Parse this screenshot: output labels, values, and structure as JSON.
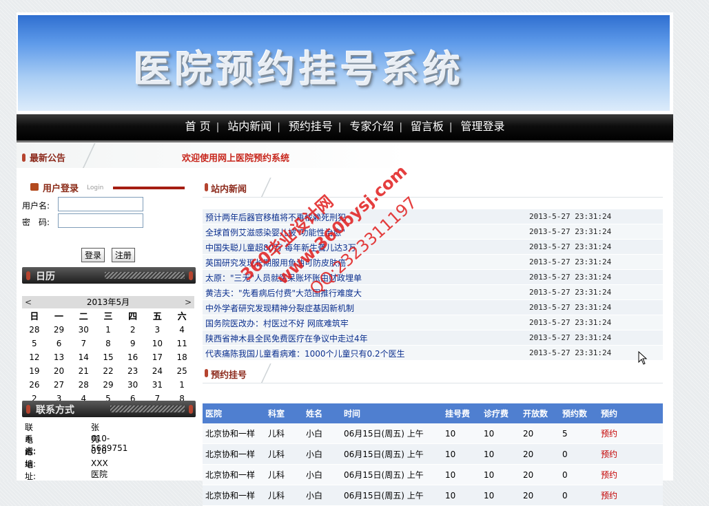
{
  "banner": {
    "title": "医院预约挂号系统"
  },
  "nav": {
    "items": [
      "首 页",
      "站内新闻",
      "预约挂号",
      "专家介绍",
      "留言板",
      "管理登录"
    ]
  },
  "notice": {
    "label": "最新公告",
    "message": "欢迎使用网上医院预约系统"
  },
  "login": {
    "title": "用户登录",
    "subtitle": "Login",
    "username_label": "用户名:",
    "password_label": "密　码:",
    "username_value": "",
    "password_value": "",
    "login_button": "登录",
    "register_button": "注册"
  },
  "calendar": {
    "title": "日历",
    "month_label": "2013年5月",
    "prev": "<",
    "next": ">",
    "weekdays": [
      "日",
      "一",
      "二",
      "三",
      "四",
      "五",
      "六"
    ],
    "weeks": [
      [
        "28",
        "29",
        "30",
        "1",
        "2",
        "3",
        "4"
      ],
      [
        "5",
        "6",
        "7",
        "8",
        "9",
        "10",
        "11"
      ],
      [
        "12",
        "13",
        "14",
        "15",
        "16",
        "17",
        "18"
      ],
      [
        "19",
        "20",
        "21",
        "22",
        "23",
        "24",
        "25"
      ],
      [
        "26",
        "27",
        "28",
        "29",
        "30",
        "31",
        "1"
      ],
      [
        "2",
        "3",
        "4",
        "5",
        "6",
        "7",
        "8"
      ]
    ]
  },
  "contact": {
    "title": "联系方式",
    "rows": [
      {
        "key": "联系人:",
        "value": "张亮"
      },
      {
        "key": "电话:",
        "value": "010-5689751"
      },
      {
        "key": "邮编:",
        "value": "010"
      },
      {
        "key": "地址:",
        "value": "XXX医院"
      }
    ]
  },
  "news": {
    "title": "站内新闻",
    "items": [
      {
        "title": "预计两年后器官移植将不再依赖死刑犯",
        "date": "2013-5-27 23:31:24"
      },
      {
        "title": "全球首例艾滋感染婴儿被\"功能性治愈\"",
        "date": "2013-5-27 23:31:24"
      },
      {
        "title": "中国失聪儿童超80万 每年新生聋儿达3万",
        "date": "2013-5-27 23:31:24"
      },
      {
        "title": "英国研究发现长期服用鱼油可防皮肤癌",
        "date": "2013-5-27 23:31:24"
      },
      {
        "title": "太原：\"三无\"人员就医呆账坏账由财政埋单",
        "date": "2013-5-27 23:31:24"
      },
      {
        "title": "黄洁夫：\"先看病后付费\"大范围推行难度大",
        "date": "2013-5-27 23:31:24"
      },
      {
        "title": "中外学者研究发现精神分裂症基因新机制",
        "date": "2013-5-27 23:31:24"
      },
      {
        "title": "国务院医改办：村医过不好 网底难筑牢",
        "date": "2013-5-27 23:31:24"
      },
      {
        "title": "陕西省神木县全民免费医疗在争议中走过4年",
        "date": "2013-5-27 23:31:24"
      },
      {
        "title": "代表痛陈我国儿童看病难：1000个儿童只有0.2个医生",
        "date": "2013-5-27 23:31:24"
      }
    ]
  },
  "registration": {
    "title": "预约挂号",
    "columns": [
      "医院",
      "科室",
      "姓名",
      "时间",
      "挂号费",
      "诊疗费",
      "开放数",
      "预约数",
      "预约"
    ],
    "rows": [
      [
        "北京协和一样",
        "儿科",
        "小白",
        "06月15日(周五) 上午",
        "10",
        "10",
        "20",
        "5",
        "预约"
      ],
      [
        "北京协和一样",
        "儿科",
        "小白",
        "06月15日(周五) 上午",
        "10",
        "10",
        "20",
        "0",
        "预约"
      ],
      [
        "北京协和一样",
        "儿科",
        "小白",
        "06月15日(周五) 上午",
        "10",
        "10",
        "20",
        "0",
        "预约"
      ],
      [
        "北京协和一样",
        "儿科",
        "小白",
        "06月15日(周五) 上午",
        "10",
        "10",
        "20",
        "0",
        "预约"
      ]
    ]
  },
  "watermark": {
    "line1": "360毕业设计网",
    "line2": "www.360bysj.com",
    "line3": "QQ:2323311197"
  },
  "colors": {
    "accent_blue": "#4f7fd0",
    "link_blue": "#0b2f8e",
    "notice_red": "#c7261c",
    "book_red": "#c30000"
  }
}
